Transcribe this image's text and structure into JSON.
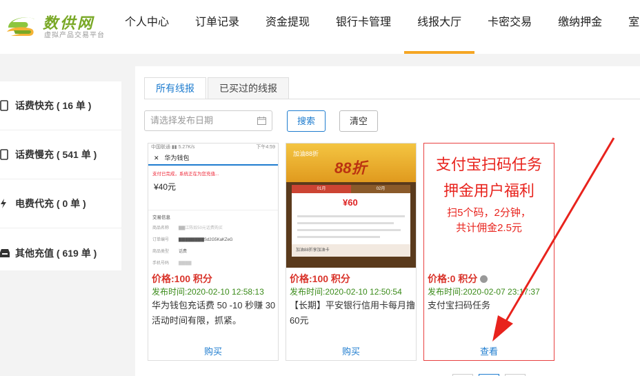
{
  "logo": {
    "title": "数供网",
    "subtitle": "虚拟产品交易平台"
  },
  "nav": [
    {
      "label": "个人中心"
    },
    {
      "label": "订单记录"
    },
    {
      "label": "资金提现"
    },
    {
      "label": "银行卡管理"
    },
    {
      "label": "线报大厅",
      "active": true
    },
    {
      "label": "卡密交易"
    },
    {
      "label": "缴纳押金"
    },
    {
      "label": "室"
    }
  ],
  "sidebar": {
    "items": [
      {
        "label": "话费快充 ( 16 单 )",
        "icon": "phone-icon"
      },
      {
        "label": "话费慢充 ( 541 单 )",
        "icon": "phone-icon"
      },
      {
        "label": "电费代充 ( 0 单 )",
        "icon": "bolt-icon"
      },
      {
        "label": "其他充值 ( 619 单 )",
        "icon": "box-icon"
      }
    ]
  },
  "tabs": [
    {
      "label": "所有线报",
      "active": true
    },
    {
      "label": "已买过的线报"
    }
  ],
  "filter": {
    "date_placeholder": "请选择发布日期",
    "search_label": "搜索",
    "clear_label": "清空"
  },
  "cards": [
    {
      "price": "价格:100 积分",
      "time": "发布时间:2020-02-10 12:58:13",
      "desc": "华为钱包充话费 50 -10 秒赚 30 活动时间有限，抓紧。",
      "action": "购买",
      "shot": {
        "status_left": "中国联通 ▮▮ 5.27K/s",
        "status_right": "下午4:59",
        "title": "华为钱包",
        "notice": "支付已完成，系统正在为您充值...",
        "amount": "¥40元",
        "section": "交易信息",
        "rows": [
          {
            "k": "商品名称",
            "v": "▇▇江陈奴50元话费购买"
          },
          {
            "k": "订单编号",
            "v": "▇▇▇▇▇▇▇▇Sd2G5KaKZeG"
          },
          {
            "k": "商品类型",
            "v": "话费"
          },
          {
            "k": "手机号码",
            "v": "▇▇▇▇"
          }
        ]
      }
    },
    {
      "price": "价格:100 积分",
      "time": "发布时间:2020-02-10 12:50:54",
      "desc": "【长期】平安银行信用卡每月撸60元",
      "action": "购买",
      "shot": {
        "headline": "加油88折",
        "banner": "88折",
        "tab_a": "01月",
        "tab_b": "02月",
        "amount": "¥60",
        "footer": "加油88折享加油卡"
      }
    },
    {
      "price": "价格:0 积分",
      "time": "发布时间:2020-02-07 23:17:37",
      "desc": "支付宝扫码任务",
      "action": "查看",
      "promo": {
        "line1": "支付宝扫码任务",
        "line2": "押金用户福利",
        "line3": "扫5个码，2分钟，",
        "line4": "共计佣金2.5元"
      }
    }
  ],
  "colors": {
    "accent": "#f5a623",
    "link": "#1e7ccf",
    "price": "#d9342b",
    "time": "#3b8b1a",
    "promo": "#e8231d",
    "arrow": "#e8231d"
  }
}
